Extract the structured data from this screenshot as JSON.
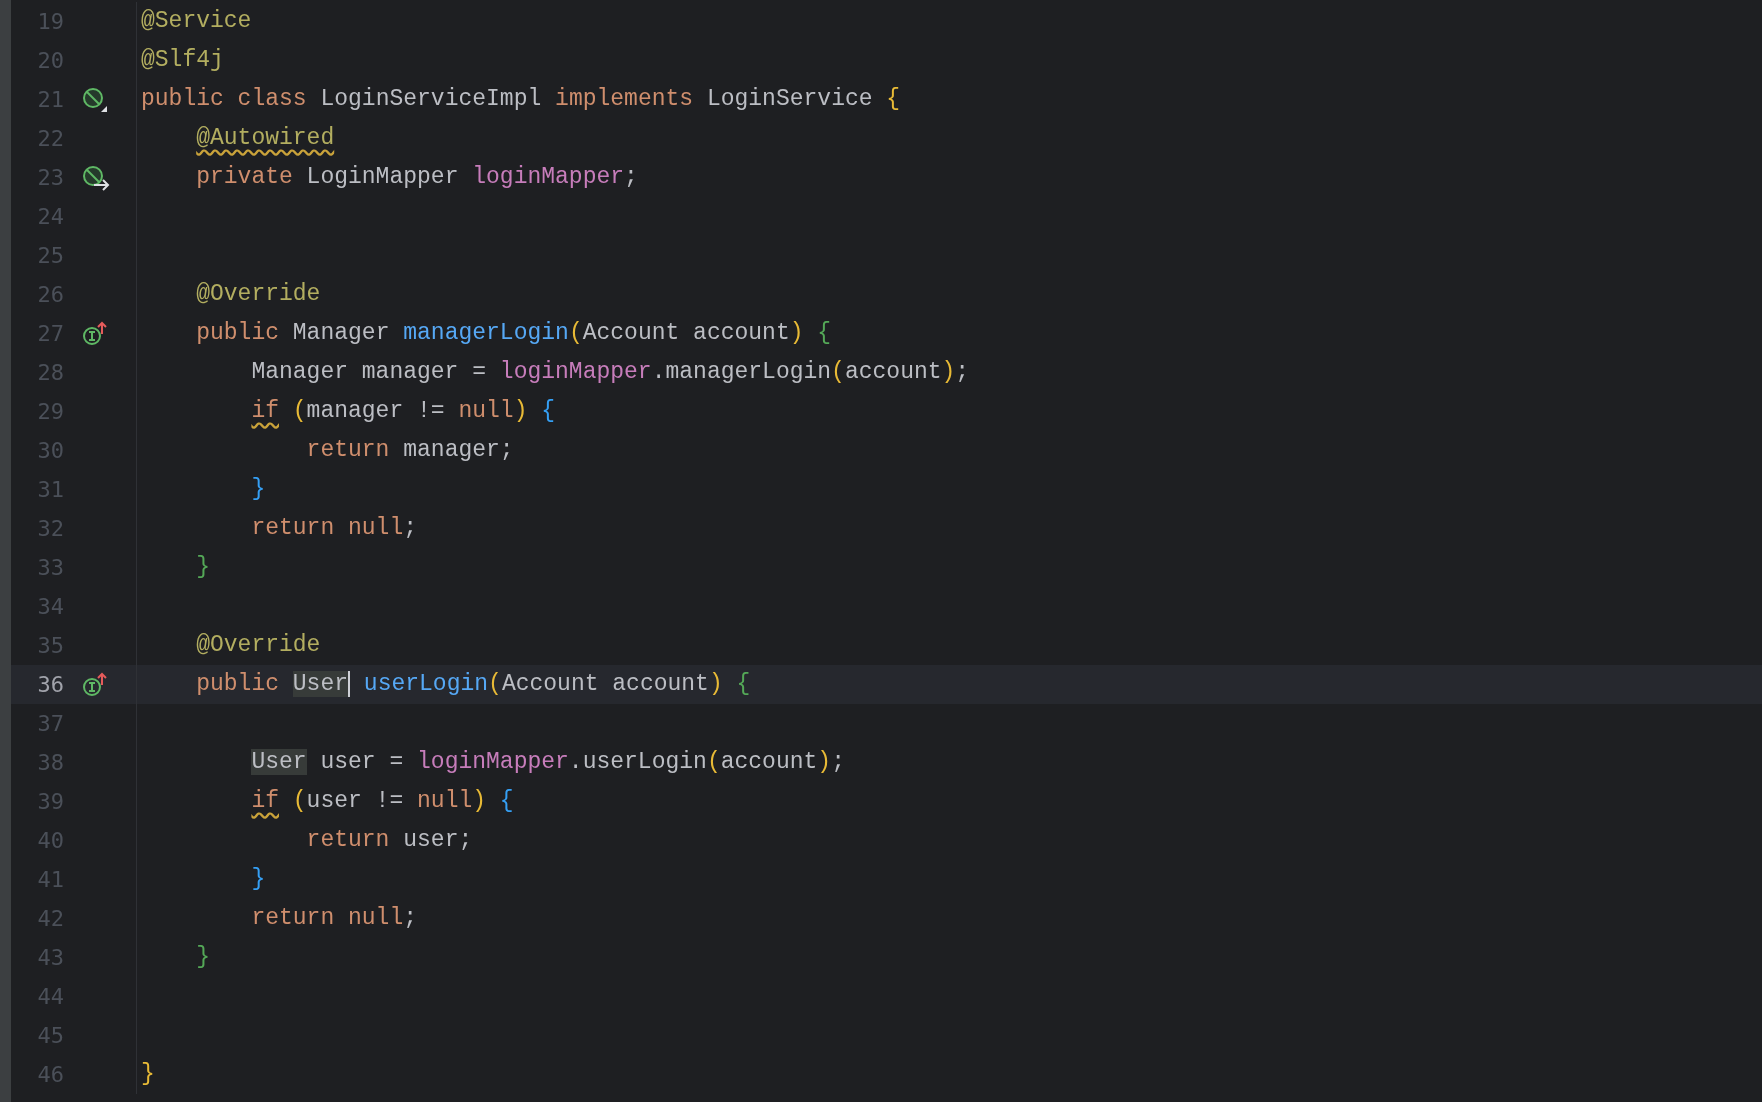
{
  "editor": {
    "lines": [
      {
        "number": "19",
        "current": false,
        "tokens": [
          {
            "text": "@Service",
            "kind": "annotation"
          }
        ]
      },
      {
        "number": "20",
        "current": false,
        "tokens": [
          {
            "text": "@Slf4j",
            "kind": "annotation"
          }
        ]
      },
      {
        "number": "21",
        "current": false,
        "marker": {
          "kind": "bean"
        },
        "tokens": [
          {
            "text": "public class ",
            "kind": "keyword"
          },
          {
            "text": "LoginServiceImpl ",
            "kind": "plain"
          },
          {
            "text": "implements ",
            "kind": "keyword"
          },
          {
            "text": "LoginService ",
            "kind": "plain"
          },
          {
            "text": "{",
            "kind": "brace1"
          }
        ],
        "children": [
          {
            "number": "22",
            "current": false,
            "tokens": [
              {
                "text": "@Autowired",
                "kind": "annotation",
                "warning": true
              }
            ]
          },
          {
            "number": "23",
            "current": false,
            "marker": {
              "kind": "injected"
            },
            "tokens": [
              {
                "text": "private ",
                "kind": "keyword"
              },
              {
                "text": "LoginMapper ",
                "kind": "plain"
              },
              {
                "text": "loginMapper",
                "kind": "field"
              },
              {
                "text": ";",
                "kind": "plain"
              }
            ]
          },
          {
            "number": "24",
            "current": false
          },
          {
            "number": "25",
            "current": false
          },
          {
            "number": "26",
            "current": false,
            "tokens": [
              {
                "text": "@Override",
                "kind": "annotation"
              }
            ]
          },
          {
            "number": "27",
            "current": false,
            "marker": {
              "kind": "implements"
            },
            "tokens": [
              {
                "text": "public ",
                "kind": "keyword"
              },
              {
                "text": "Manager ",
                "kind": "plain"
              },
              {
                "text": "managerLogin",
                "kind": "method"
              },
              {
                "text": "(",
                "kind": "brace1"
              },
              {
                "text": "Account account",
                "kind": "plain"
              },
              {
                "text": ") ",
                "kind": "brace1"
              },
              {
                "text": "{",
                "kind": "brace2"
              }
            ],
            "children": [
              {
                "number": "28",
                "current": false,
                "tokens": [
                  {
                    "text": "Manager manager = ",
                    "kind": "plain"
                  },
                  {
                    "text": "loginMapper",
                    "kind": "field"
                  },
                  {
                    "text": ".managerLogin",
                    "kind": "plain"
                  },
                  {
                    "text": "(",
                    "kind": "brace1"
                  },
                  {
                    "text": "account",
                    "kind": "plain"
                  },
                  {
                    "text": ")",
                    "kind": "brace1"
                  },
                  {
                    "text": ";",
                    "kind": "plain"
                  }
                ]
              },
              {
                "number": "29",
                "current": false,
                "tokens": [
                  {
                    "text": "if",
                    "kind": "keyword",
                    "warning": true
                  },
                  {
                    "text": " (",
                    "kind": "brace1"
                  },
                  {
                    "text": "manager != ",
                    "kind": "plain"
                  },
                  {
                    "text": "null",
                    "kind": "keyword"
                  },
                  {
                    "text": ") ",
                    "kind": "brace1"
                  },
                  {
                    "text": "{",
                    "kind": "brace3"
                  }
                ],
                "children": [
                  {
                    "number": "30",
                    "current": false,
                    "tokens": [
                      {
                        "text": "return ",
                        "kind": "keyword"
                      },
                      {
                        "text": "manager;",
                        "kind": "plain"
                      }
                    ]
                  }
                ]
              },
              {
                "number": "31",
                "current": false,
                "tokens": [
                  {
                    "text": "}",
                    "kind": "brace3"
                  }
                ]
              },
              {
                "number": "32",
                "current": false,
                "tokens": [
                  {
                    "text": "return null",
                    "kind": "keyword"
                  },
                  {
                    "text": ";",
                    "kind": "plain"
                  }
                ]
              }
            ]
          },
          {
            "number": "33",
            "current": false,
            "tokens": [
              {
                "text": "}",
                "kind": "brace2"
              }
            ]
          },
          {
            "number": "34",
            "current": false
          },
          {
            "number": "35",
            "current": false,
            "tokens": [
              {
                "text": "@Override",
                "kind": "annotation"
              }
            ]
          },
          {
            "number": "36",
            "current": true,
            "marker": {
              "kind": "implements"
            },
            "tokens": [
              {
                "text": "public ",
                "kind": "keyword"
              },
              {
                "text": "User",
                "kind": "plain",
                "occurrence": true,
                "caret_after": true
              },
              {
                "text": " userLogin",
                "kind": "method"
              },
              {
                "text": "(",
                "kind": "brace1"
              },
              {
                "text": "Account account",
                "kind": "plain"
              },
              {
                "text": ") ",
                "kind": "brace1"
              },
              {
                "text": "{",
                "kind": "brace2"
              }
            ],
            "children": [
              {
                "number": "37",
                "current": false
              },
              {
                "number": "38",
                "current": false,
                "tokens": [
                  {
                    "text": "User",
                    "kind": "plain",
                    "occurrence": true
                  },
                  {
                    "text": " user = ",
                    "kind": "plain"
                  },
                  {
                    "text": "loginMapper",
                    "kind": "field"
                  },
                  {
                    "text": ".userLogin",
                    "kind": "plain"
                  },
                  {
                    "text": "(",
                    "kind": "brace1"
                  },
                  {
                    "text": "account",
                    "kind": "plain"
                  },
                  {
                    "text": ")",
                    "kind": "brace1"
                  },
                  {
                    "text": ";",
                    "kind": "plain"
                  }
                ]
              },
              {
                "number": "39",
                "current": false,
                "tokens": [
                  {
                    "text": "if",
                    "kind": "keyword",
                    "warning": true
                  },
                  {
                    "text": " (",
                    "kind": "brace1"
                  },
                  {
                    "text": "user != ",
                    "kind": "plain"
                  },
                  {
                    "text": "null",
                    "kind": "keyword"
                  },
                  {
                    "text": ") ",
                    "kind": "brace1"
                  },
                  {
                    "text": "{",
                    "kind": "brace3"
                  }
                ],
                "children": [
                  {
                    "number": "40",
                    "current": false,
                    "tokens": [
                      {
                        "text": "return ",
                        "kind": "keyword"
                      },
                      {
                        "text": "user;",
                        "kind": "plain"
                      }
                    ]
                  }
                ]
              },
              {
                "number": "41",
                "current": false,
                "tokens": [
                  {
                    "text": "}",
                    "kind": "brace3"
                  }
                ]
              },
              {
                "number": "42",
                "current": false,
                "tokens": [
                  {
                    "text": "return null",
                    "kind": "keyword"
                  },
                  {
                    "text": ";",
                    "kind": "plain"
                  }
                ]
              }
            ]
          },
          {
            "number": "43",
            "current": false,
            "tokens": [
              {
                "text": "}",
                "kind": "brace2"
              }
            ]
          },
          {
            "number": "44",
            "current": false
          },
          {
            "number": "45",
            "current": false
          }
        ]
      },
      {
        "number": "46",
        "current": false,
        "tokens": [
          {
            "text": "}",
            "kind": "brace1"
          }
        ]
      }
    ]
  }
}
